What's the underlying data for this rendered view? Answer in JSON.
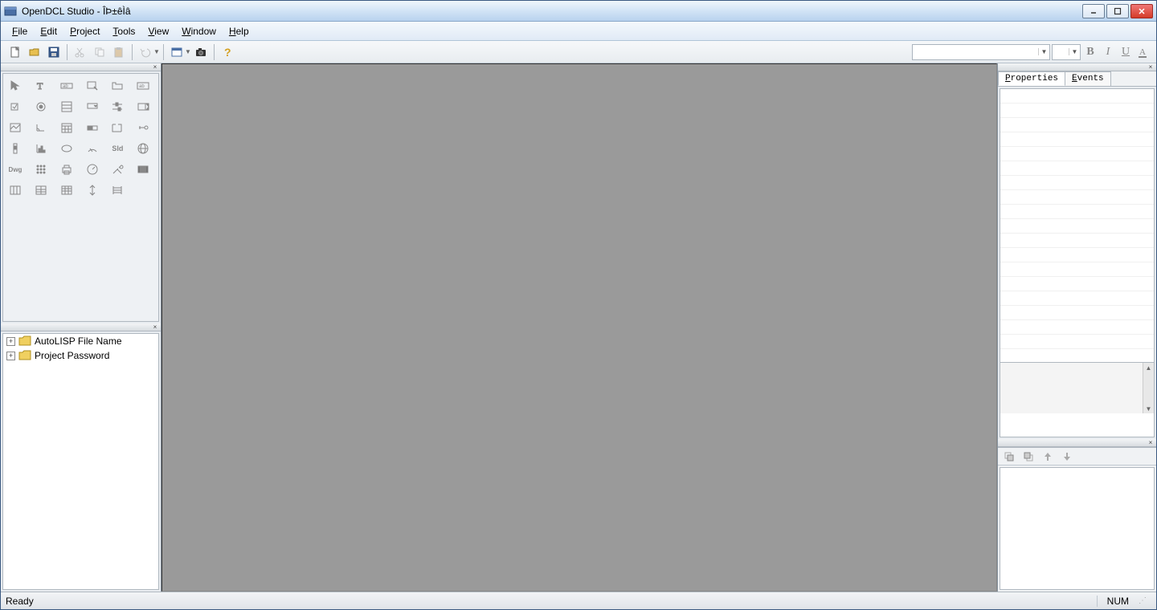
{
  "title": "OpenDCL Studio - ÎÞ±êÌâ",
  "menu": {
    "file": {
      "u": "F",
      "rest": "ile"
    },
    "edit": {
      "u": "E",
      "rest": "dit"
    },
    "project": {
      "u": "P",
      "rest": "roject"
    },
    "tools": {
      "u": "T",
      "rest": "ools"
    },
    "view": {
      "u": "V",
      "rest": "iew"
    },
    "window": {
      "u": "W",
      "rest": "indow"
    },
    "help": {
      "u": "H",
      "rest": "elp"
    }
  },
  "tree": {
    "item1": "AutoLISP File Name",
    "item2": "Project Password"
  },
  "tabs": {
    "properties": {
      "u": "P",
      "rest": "roperties"
    },
    "events": {
      "u": "E",
      "rest": "vents"
    }
  },
  "format": {
    "bold": "B",
    "italic": "I",
    "underline": "U"
  },
  "status": {
    "ready": "Ready",
    "num": "NUM"
  },
  "toolbox": {
    "sld": "Sld",
    "dwg": "Dwg"
  }
}
